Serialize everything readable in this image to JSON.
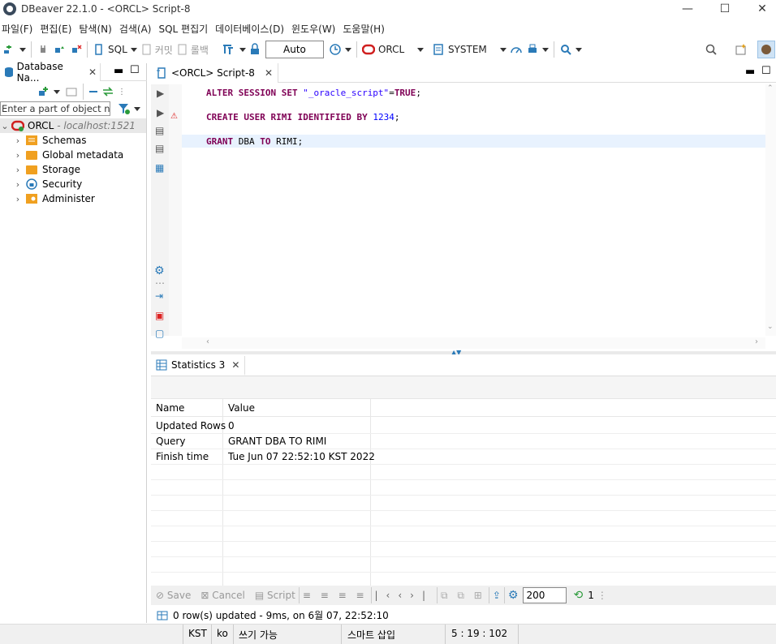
{
  "window": {
    "title": "DBeaver 22.1.0 - <ORCL> Script-8",
    "minimize": "—",
    "maximize": "☐",
    "close": "✕"
  },
  "menu": [
    "파일(F)",
    "편집(E)",
    "탐색(N)",
    "검색(A)",
    "SQL 편집기",
    "데이터베이스(D)",
    "윈도우(W)",
    "도움말(H)"
  ],
  "toolbar": {
    "sql": "SQL",
    "commit": "커밋",
    "rollback": "롤백",
    "mode": "Auto",
    "connection": "ORCL",
    "schema": "SYSTEM",
    "colors": {
      "oracle": "#d02020",
      "accent": "#1c6fb5"
    }
  },
  "navigator": {
    "tab": "Database Na...",
    "filter_placeholder": "Enter a part of object nar",
    "connection": {
      "name": "ORCL",
      "host": " - localhost:1521"
    },
    "items": [
      {
        "label": "Schemas",
        "icon": "schemas-icon"
      },
      {
        "label": "Global metadata",
        "icon": "folder-icon"
      },
      {
        "label": "Storage",
        "icon": "folder-icon"
      },
      {
        "label": "Security",
        "icon": "security-icon"
      },
      {
        "label": "Administer",
        "icon": "administer-icon"
      }
    ]
  },
  "editor": {
    "tab": "<ORCL> Script-8",
    "lines": [
      {
        "kw1": "ALTER SESSION SET ",
        "str": "\"_oracle_script\"",
        "rest": "=",
        "kw2": "TRUE",
        "end": ";"
      },
      {
        "kw1": "CREATE USER ",
        "id": "RIMI ",
        "kw2": "IDENTIFIED BY ",
        "num": "1234",
        "end": ";"
      },
      {
        "kw1": "GRANT ",
        "id": "DBA ",
        "kw2": "TO ",
        "id2": "RIMI",
        "end": ";"
      }
    ]
  },
  "results": {
    "tab": "Statistics 3",
    "columns": [
      "Name",
      "Value"
    ],
    "rows": [
      {
        "name": "Updated Rows",
        "value": "0"
      },
      {
        "name": "Query",
        "value": "GRANT DBA TO RIMI"
      },
      {
        "name": "Finish time",
        "value": "Tue Jun 07 22:52:10 KST 2022"
      }
    ],
    "bottom": {
      "save": "Save",
      "cancel": "Cancel",
      "script": "Script",
      "fetch_size": "200",
      "count": "1"
    },
    "status": "0 row(s) updated - 9ms, on 6월 07, 22:52:10"
  },
  "statusbar": {
    "tz": "KST",
    "lang": "ko",
    "write": "쓰기 가능",
    "insert": "스마트 삽입",
    "pos": "5 : 19 : 102"
  }
}
